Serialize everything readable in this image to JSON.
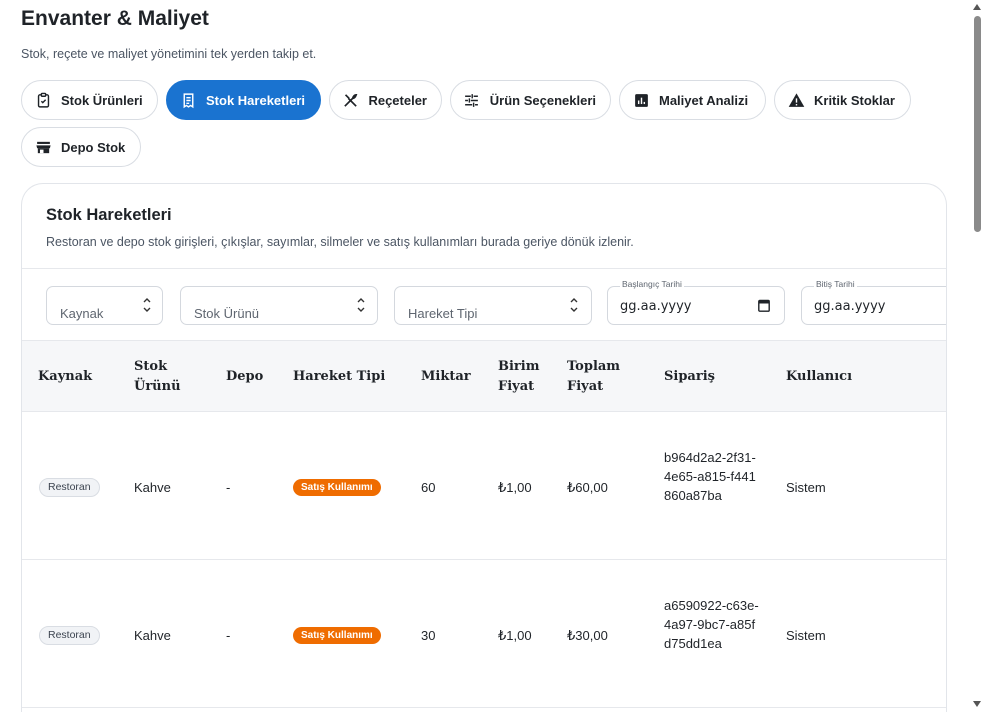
{
  "header": {
    "title": "Envanter & Maliyet",
    "subtitle": "Stok, reçete ve maliyet yönetimini tek yerden takip et."
  },
  "tabs": [
    {
      "label": "Stok Ürünleri",
      "icon": "clipboard-icon",
      "active": false
    },
    {
      "label": "Stok Hareketleri",
      "icon": "receipt-icon",
      "active": true
    },
    {
      "label": "Reçeteler",
      "icon": "utensils-icon",
      "active": false
    },
    {
      "label": "Ürün Seçenekleri",
      "icon": "sliders-icon",
      "active": false
    },
    {
      "label": "Maliyet Analizi",
      "icon": "chart-icon",
      "active": false
    },
    {
      "label": "Kritik Stoklar",
      "icon": "warning-icon",
      "active": false
    },
    {
      "label": "Depo Stok",
      "icon": "store-icon",
      "active": false
    }
  ],
  "section": {
    "title": "Stok Hareketleri",
    "description": "Restoran ve depo stok girişleri, çıkışlar, sayımlar, silmeler ve satış kullanımları burada geriye dönük izlenir."
  },
  "filters": {
    "source_placeholder": "Kaynak",
    "product_placeholder": "Stok Ürünü",
    "type_placeholder": "Hareket Tipi",
    "start_date_label": "Başlangıç Tarihi",
    "start_date_value": "gg.aa.yyyy",
    "end_date_label": "Bitiş Tarihi",
    "end_date_value": "gg.aa.yyyy"
  },
  "table": {
    "columns": [
      "Kaynak",
      "Stok Ürünü",
      "Depo",
      "Hareket Tipi",
      "Miktar",
      "Birim Fiyat",
      "Toplam Fiyat",
      "Sipariş",
      "Kullanıcı"
    ],
    "rows": [
      {
        "source": "Restoran",
        "product": "Kahve",
        "depot": "-",
        "type": "Satış Kullanımı",
        "quantity": "60",
        "unit_price": "₺1,00",
        "total_price": "₺60,00",
        "order": "b964d2a2-2f31-4e65-a815-f441860a87ba",
        "user": "Sistem"
      },
      {
        "source": "Restoran",
        "product": "Kahve",
        "depot": "-",
        "type": "Satış Kullanımı",
        "quantity": "30",
        "unit_price": "₺1,00",
        "total_price": "₺30,00",
        "order": "a6590922-c63e-4a97-9bc7-a85fd75dd1ea",
        "user": "Sistem"
      }
    ]
  },
  "colors": {
    "accent": "#1a73d0",
    "type_badge": "#ef6c00"
  }
}
